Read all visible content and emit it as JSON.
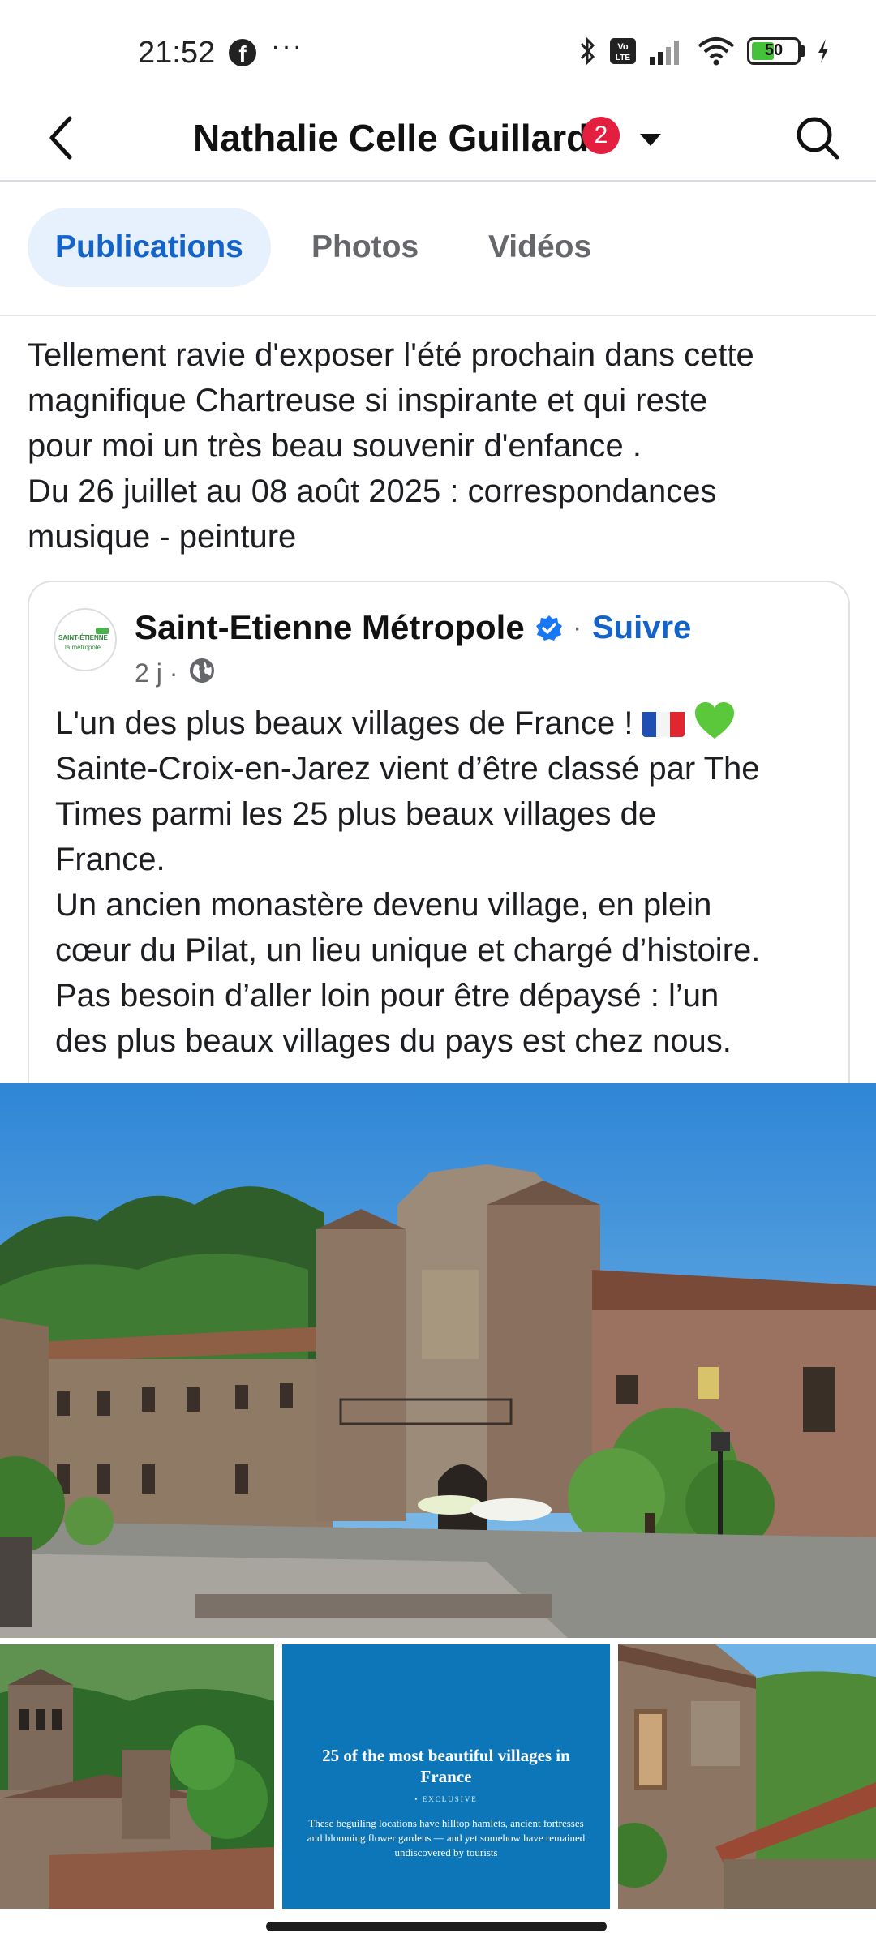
{
  "status_bar": {
    "time": "21:52",
    "dots": "···",
    "battery": "50",
    "icons": [
      "facebook-icon",
      "bluetooth-icon",
      "volte-icon",
      "signal-icon",
      "wifi-icon",
      "battery-icon",
      "charging-icon"
    ]
  },
  "header": {
    "title": "Nathalie Celle Guillard",
    "badge_count": "2"
  },
  "tabs": [
    {
      "label": "Publications",
      "active": true
    },
    {
      "label": "Photos",
      "active": false
    },
    {
      "label": "Vidéos",
      "active": false
    }
  ],
  "post": {
    "text_lines": [
      "Tellement ravie d'exposer l'été prochain dans cette",
      "magnifique Chartreuse si inspirante et qui reste",
      "pour moi un très beau souvenir d'enfance .",
      "Du 26 juillet au 08 août 2025 : correspondances",
      "musique - peinture"
    ]
  },
  "shared": {
    "page_name": "Saint-Etienne Métropole",
    "separator": "·",
    "follow": "Suivre",
    "time": "2 j ·",
    "avatar_line1": "SAINT-ÉTIENNE",
    "avatar_line2": "la métropole",
    "line1": "L'un des plus beaux villages de France !",
    "text_lines": [
      "Sainte-Croix-en-Jarez vient d’être classé par The",
      "Times parmi les 25 plus beaux villages de",
      "France.",
      "Un ancien monastère devenu village, en plein",
      "cœur du Pilat, un lieu unique et chargé d’histoire.",
      "Pas besoin d’aller loin pour être dépaysé : l’un",
      "des plus beaux villages du pays est chez nous."
    ]
  },
  "article_thumb": {
    "title": "25 of the most beautiful villages in France",
    "kicker": "• EXCLUSIVE",
    "subtitle": "These beguiling locations have hilltop hamlets, ancient fortresses and blooming flower gardens — and yet somehow have remained undiscovered by tourists"
  },
  "colors": {
    "accent": "#1463c9",
    "badge": "#e41e3f",
    "tab_active_bg": "#e7f0fd",
    "article_bg": "#0d76b8"
  }
}
